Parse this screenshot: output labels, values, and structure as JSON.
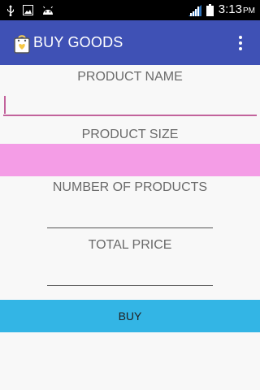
{
  "status_bar": {
    "icons": [
      "usb-icon",
      "image-icon",
      "android-icon"
    ],
    "time": "3:13",
    "ampm": "PM"
  },
  "app_bar": {
    "title": "BUY GOODS",
    "background": "#3f51b5"
  },
  "form": {
    "product_name_label": "PRODUCT NAME",
    "product_name_value": "",
    "product_size_label": "PRODUCT SIZE",
    "product_size_value": "",
    "number_of_products_label": "NUMBER OF PRODUCTS",
    "number_of_products_value": "",
    "total_price_label": "TOTAL PRICE",
    "total_price_value": "",
    "buy_button_label": "BUY"
  },
  "colors": {
    "accent": "#c2639c",
    "size_field": "#f49de6",
    "buy_button": "#33b5e5"
  }
}
